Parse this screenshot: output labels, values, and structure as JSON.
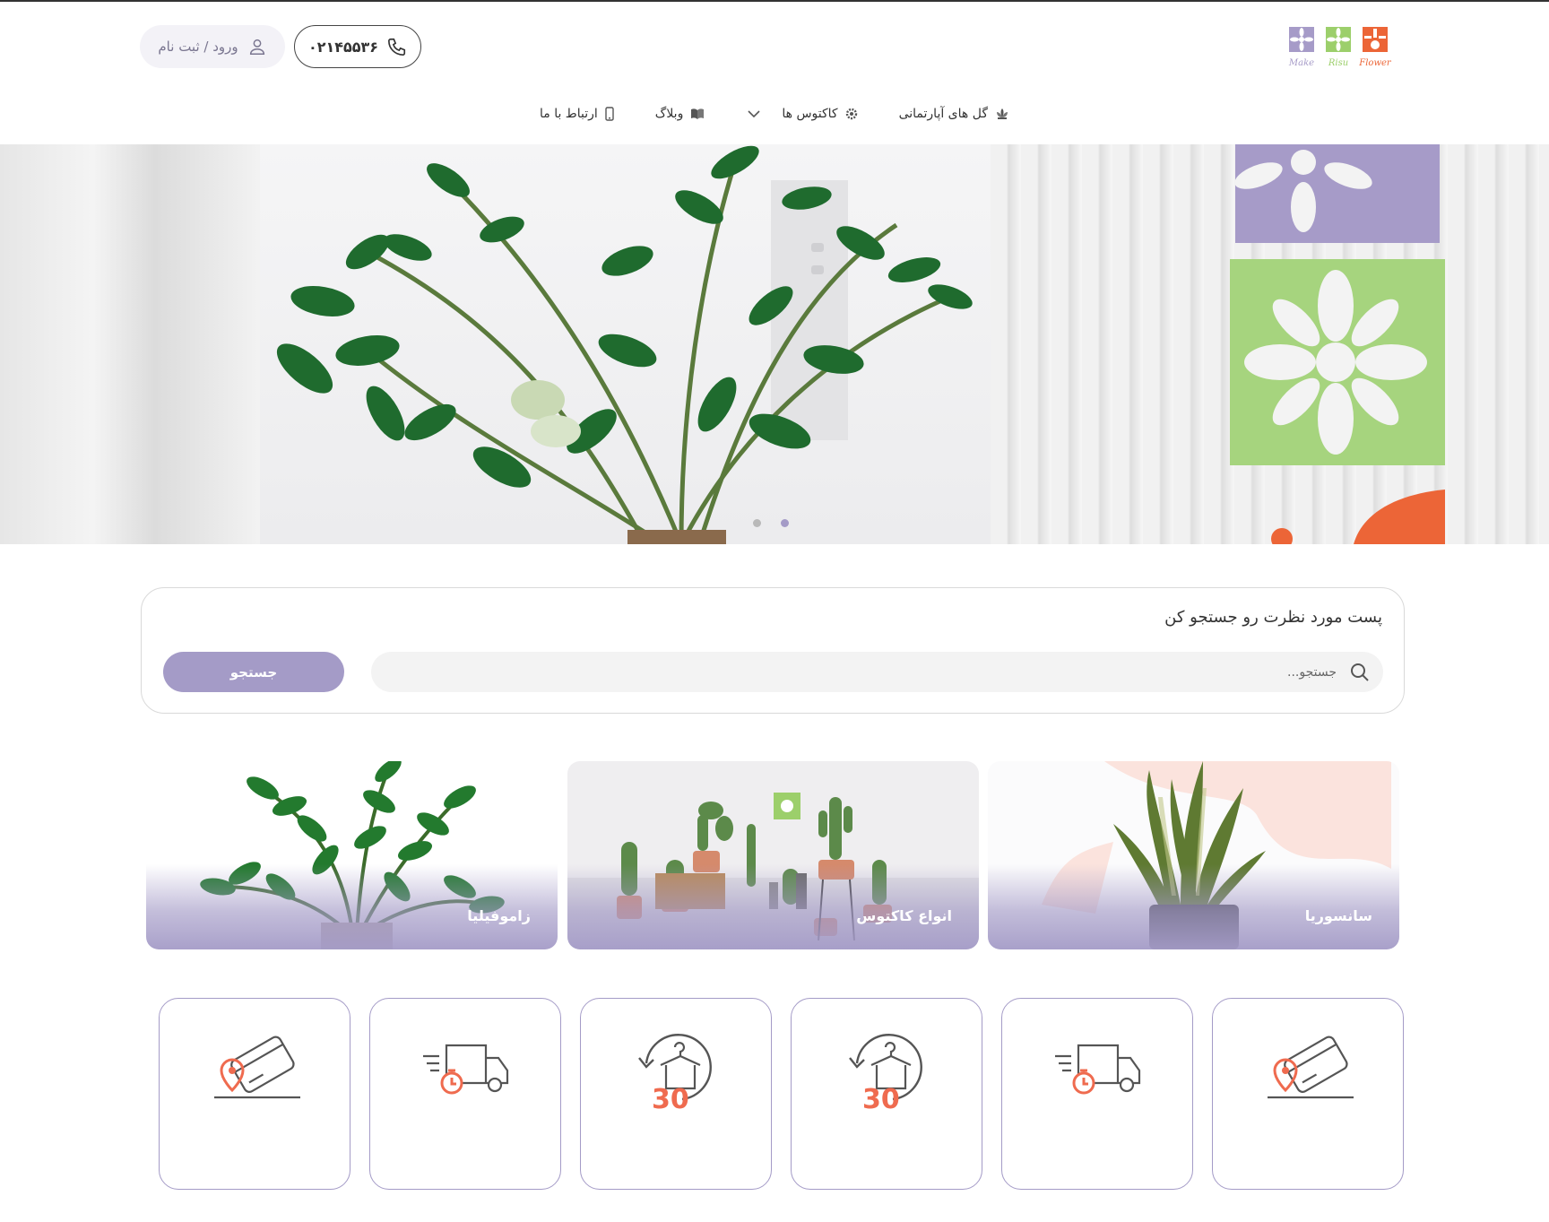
{
  "header": {
    "logo_icon": "make-risu-flower-logo",
    "logo_words": [
      "Make",
      "Risu",
      "Flower"
    ],
    "phone": "۰۲۱۴۵۵۳۶",
    "phone_icon": "phone-icon",
    "login_label": "ورود / ثبت نام",
    "login_icon": "user-icon"
  },
  "nav": {
    "items": [
      {
        "label": "گل های آپارتمانی",
        "icon": "lotus-icon"
      },
      {
        "label": "کاکتوس ها",
        "icon": "gear-icon",
        "has_dropdown": true
      },
      {
        "label": "وبلاگ",
        "icon": "book-icon"
      },
      {
        "label": "ارتباط با ما",
        "icon": "mobile-icon"
      }
    ]
  },
  "hero": {
    "slides": 2
  },
  "search": {
    "title": "پست مورد نظرت رو جستجو کن",
    "placeholder": "جستجو...",
    "button_label": "جستجو"
  },
  "categories": [
    {
      "label": "سانسوریا"
    },
    {
      "label": "انواع کاکتوس"
    },
    {
      "label": "زاموفیلیا"
    }
  ],
  "features": [
    {
      "icon": "card-location-icon"
    },
    {
      "icon": "fast-delivery-truck-icon"
    },
    {
      "icon": "return-30-days-icon",
      "number": "30"
    },
    {
      "icon": "return-30-days-icon",
      "number": "30"
    },
    {
      "icon": "fast-delivery-truck-icon"
    },
    {
      "icon": "card-location-icon"
    }
  ],
  "colors": {
    "accent": "#a49bc7",
    "icon_orange": "#ef6b4f",
    "logo_purple": "#a69bc8",
    "logo_green": "#9ccf6b",
    "logo_orange": "#ec6537"
  }
}
